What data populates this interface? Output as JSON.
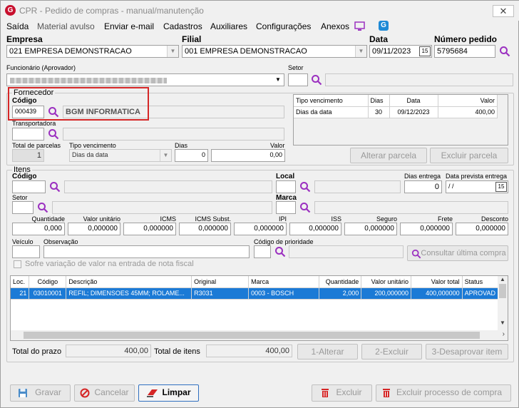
{
  "window": {
    "title": "CPR - Pedido de compras - manual/manutenção",
    "close": "✕"
  },
  "menu": [
    "Saída",
    "Material avulso",
    "Enviar e-mail",
    "Cadastros",
    "Auxiliares",
    "Configurações",
    "Anexos"
  ],
  "header": {
    "empresa_label": "Empresa",
    "empresa_value": "021 EMPRESA DEMONSTRACAO",
    "filial_label": "Filial",
    "filial_value": "001 EMPRESA DEMONSTRACAO",
    "data_label": "Data",
    "data_value": "09/11/2023",
    "numero_label": "Número pedido",
    "numero_value": "5795684",
    "funcionario_label": "Funcionário (Aprovador)",
    "funcionario_value": "",
    "setor_label": "Setor"
  },
  "fornecedor": {
    "group_title": "Fornecedor",
    "codigo_label": "Código",
    "codigo_value": "000439",
    "nome_value": "BGM INFORMATICA",
    "transportadora_label": "Transportadora",
    "total_parcelas_label": "Total de parcelas",
    "total_parcelas_value": "1",
    "tipo_venc_label": "Tipo vencimento",
    "tipo_venc_value": "Dias da data",
    "dias_label": "Dias",
    "dias_value": "0",
    "valor_label": "Valor",
    "valor_value": "0,00",
    "grid_headers": [
      "Tipo vencimento",
      "Dias",
      "Data",
      "Valor"
    ],
    "grid_rows": [
      [
        "Dias da data",
        "30",
        "09/12/2023",
        "400,00"
      ]
    ],
    "alterar_parcela": "Alterar parcela",
    "excluir_parcela": "Excluir parcela"
  },
  "itens": {
    "group_title": "Itens",
    "codigo_label": "Código",
    "local_label": "Local",
    "dias_entrega_label": "Dias entrega",
    "dias_entrega_value": "0",
    "data_prevista_label": "Data prevista entrega",
    "data_prevista_value": "/ /",
    "setor_label": "Setor",
    "marca_label": "Marca",
    "num_labels": [
      "Quantidade",
      "Valor unitário",
      "ICMS",
      "ICMS Subst.",
      "IPI",
      "ISS",
      "Seguro",
      "Frete",
      "Desconto"
    ],
    "num_values": [
      "0,000",
      "0,000000",
      "0,000000",
      "0,000000",
      "0,000000",
      "0,000000",
      "0,000000",
      "0,000000",
      "0,000000"
    ],
    "veiculo_label": "Veículo",
    "observacao_label": "Observação",
    "prioridade_label": "Código de prioridade",
    "sofre_variacao": "Sofre variação de valor na entrada de nota fiscal",
    "consultar": "Consultar última compra",
    "grid_headers": [
      "Loc.",
      "Código",
      "Descrição",
      "Original",
      "Marca",
      "Quantidade",
      "Valor unitário",
      "Valor total",
      "Status"
    ],
    "grid_rows": [
      [
        "21",
        "03010001",
        "REFIL; DIMENSOES 45MM; ROLAME...",
        "R3031",
        "0003 - BOSCH",
        "2,000",
        "200,000000",
        "400,000000",
        "APROVAD"
      ]
    ],
    "total_prazo_label": "Total do prazo",
    "total_prazo_value": "400,00",
    "total_itens_label": "Total de itens",
    "total_itens_value": "400,00",
    "alterar": "1-Alterar",
    "excluir": "2-Excluir",
    "desaprovar": "3-Desaprovar item"
  },
  "footer": {
    "gravar": "Gravar",
    "cancelar": "Cancelar",
    "limpar": "Limpar",
    "excluir": "Excluir",
    "excluir_processo": "Excluir processo de compra"
  },
  "colors": {
    "accent": "#1b7ad6",
    "highlight": "#d52626",
    "brand": "#c8102e"
  }
}
